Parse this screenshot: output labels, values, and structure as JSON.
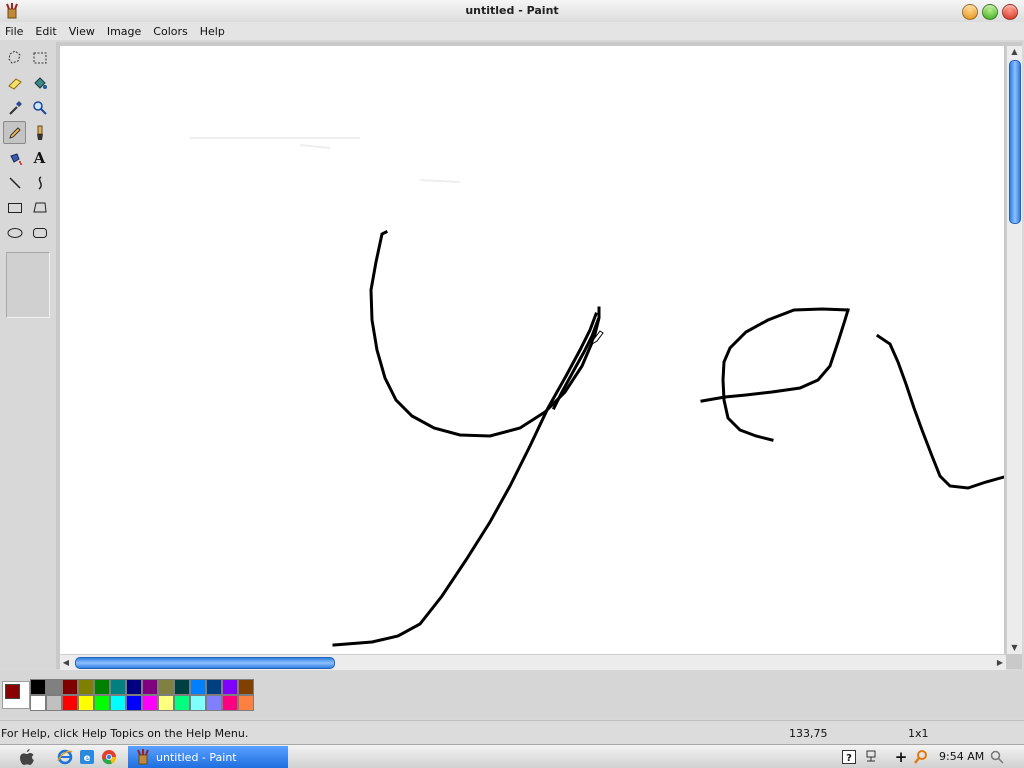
{
  "window": {
    "title": "untitled - Paint",
    "app_icon": "paint-app-icon"
  },
  "menu": {
    "items": [
      "File",
      "Edit",
      "View",
      "Image",
      "Colors",
      "Help"
    ]
  },
  "toolbox": {
    "tools": [
      {
        "name": "free-form-select-icon",
        "selected": false
      },
      {
        "name": "rect-select-icon",
        "selected": false
      },
      {
        "name": "eraser-icon",
        "selected": false
      },
      {
        "name": "fill-bucket-icon",
        "selected": false
      },
      {
        "name": "color-picker-icon",
        "selected": false
      },
      {
        "name": "magnifier-icon",
        "selected": false
      },
      {
        "name": "pencil-icon",
        "selected": true
      },
      {
        "name": "brush-icon",
        "selected": false
      },
      {
        "name": "airbrush-icon",
        "selected": false
      },
      {
        "name": "text-icon",
        "selected": false,
        "glyph": "A"
      },
      {
        "name": "line-icon",
        "selected": false
      },
      {
        "name": "curve-icon",
        "selected": false
      },
      {
        "name": "rectangle-icon",
        "selected": false
      },
      {
        "name": "polygon-icon",
        "selected": false
      },
      {
        "name": "ellipse-icon",
        "selected": false
      },
      {
        "name": "rounded-rect-icon",
        "selected": false
      }
    ]
  },
  "palette": {
    "foreground": "#8b0000",
    "background": "#ffffff",
    "colors": [
      "#000000",
      "#808080",
      "#800000",
      "#808000",
      "#008000",
      "#008080",
      "#000080",
      "#800080",
      "#808040",
      "#004040",
      "#0080ff",
      "#004080",
      "#8000ff",
      "#804000",
      "#ffffff",
      "#c0c0c0",
      "#ff0000",
      "#ffff00",
      "#00ff00",
      "#00ffff",
      "#0000ff",
      "#ff00ff",
      "#ffff80",
      "#00ff80",
      "#80ffff",
      "#8080ff",
      "#ff0080",
      "#ff8040"
    ]
  },
  "status": {
    "help": "For Help, click Help Topics on the Help Menu.",
    "coords": "133,75",
    "size": "1x1"
  },
  "taskbar": {
    "task_label": "untitled - Paint",
    "time": "9:54 AM"
  }
}
